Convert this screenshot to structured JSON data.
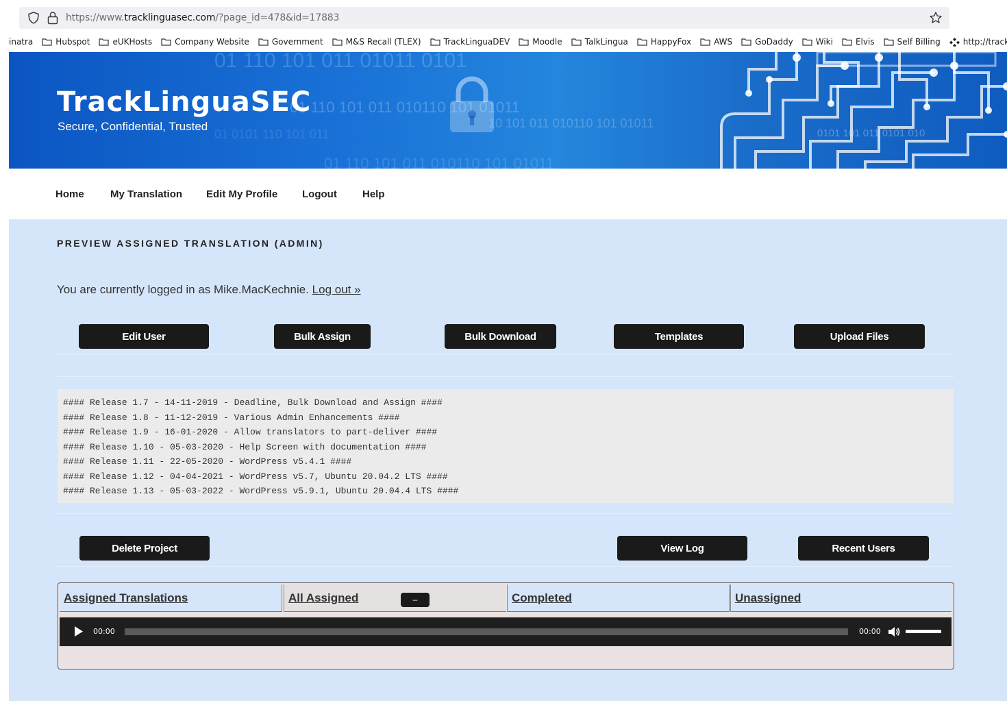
{
  "browser": {
    "url_prefix": "https://www.",
    "url_host": "tracklinguasec.com",
    "url_path": "/?page_id=478&id=17883"
  },
  "bookmarks": {
    "partial_first": "inatra",
    "items": [
      "Hubspot",
      "eUKHosts",
      "Company Website",
      "Government",
      "M&S Recall (TLEX)",
      "TrackLinguaDEV",
      "Moodle",
      "TalkLingua",
      "HappyFox",
      "AWS",
      "GoDaddy",
      "Wiki",
      "Elvis",
      "Self Billing"
    ],
    "last": "http://tracklingua.k-n..."
  },
  "header": {
    "title": "TrackLinguaSEC",
    "tagline": "Secure, Confidential, Trusted",
    "binary": [
      "01 110 101 011 01011 0101",
      "01 110 101 011 010110 101 01011",
      "10 101 011 010110 101 01011",
      "01 110 101 011 010110 101 01011",
      "01 0101 110 101 011",
      "0101 101 011 0101 010"
    ]
  },
  "nav": {
    "items": [
      "Home",
      "My Translation",
      "Edit My Profile",
      "Logout",
      "Help"
    ]
  },
  "page": {
    "title": "PREVIEW ASSIGNED TRANSLATION (ADMIN)",
    "logged_in_text": "You are currently logged in as Mike.MacKechnie.",
    "logout_link": "Log out »"
  },
  "buttons_top": [
    "Edit User",
    "Bulk Assign",
    "Bulk Download",
    "Templates",
    "Upload Files"
  ],
  "changelog": [
    "#### Release 1.7 - 14-11-2019 - Deadline, Bulk Download and Assign ####",
    "#### Release 1.8 - 11-12-2019 - Various Admin Enhancements ####",
    "#### Release 1.9 - 16-01-2020 - Allow translators to part-deliver ####",
    "#### Release 1.10 - 05-03-2020 - Help Screen with documentation ####",
    "#### Release 1.11 - 22-05-2020 - WordPress v5.4.1 ####",
    "#### Release 1.12 - 04-04-2021 - WordPress v5.7, Ubuntu 20.04.2 LTS ####",
    "#### Release 1.13 - 05-03-2022 - WordPress v5.9.1, Ubuntu 20.04.4 LTS ####"
  ],
  "buttons_bottom": [
    "Delete Project",
    "View Log",
    "Recent Users"
  ],
  "tabs": {
    "items": [
      "Assigned Translations",
      "All Assigned",
      "Completed",
      "Unassigned"
    ],
    "mini_button": "–"
  },
  "player": {
    "current_time": "00:00",
    "duration": "00:00",
    "progress": 0,
    "volume": 1
  },
  "colors": {
    "content_bg": "#d5e6fb",
    "button_bg": "#1a1a1a",
    "banner_blue": "#1a73d8"
  }
}
